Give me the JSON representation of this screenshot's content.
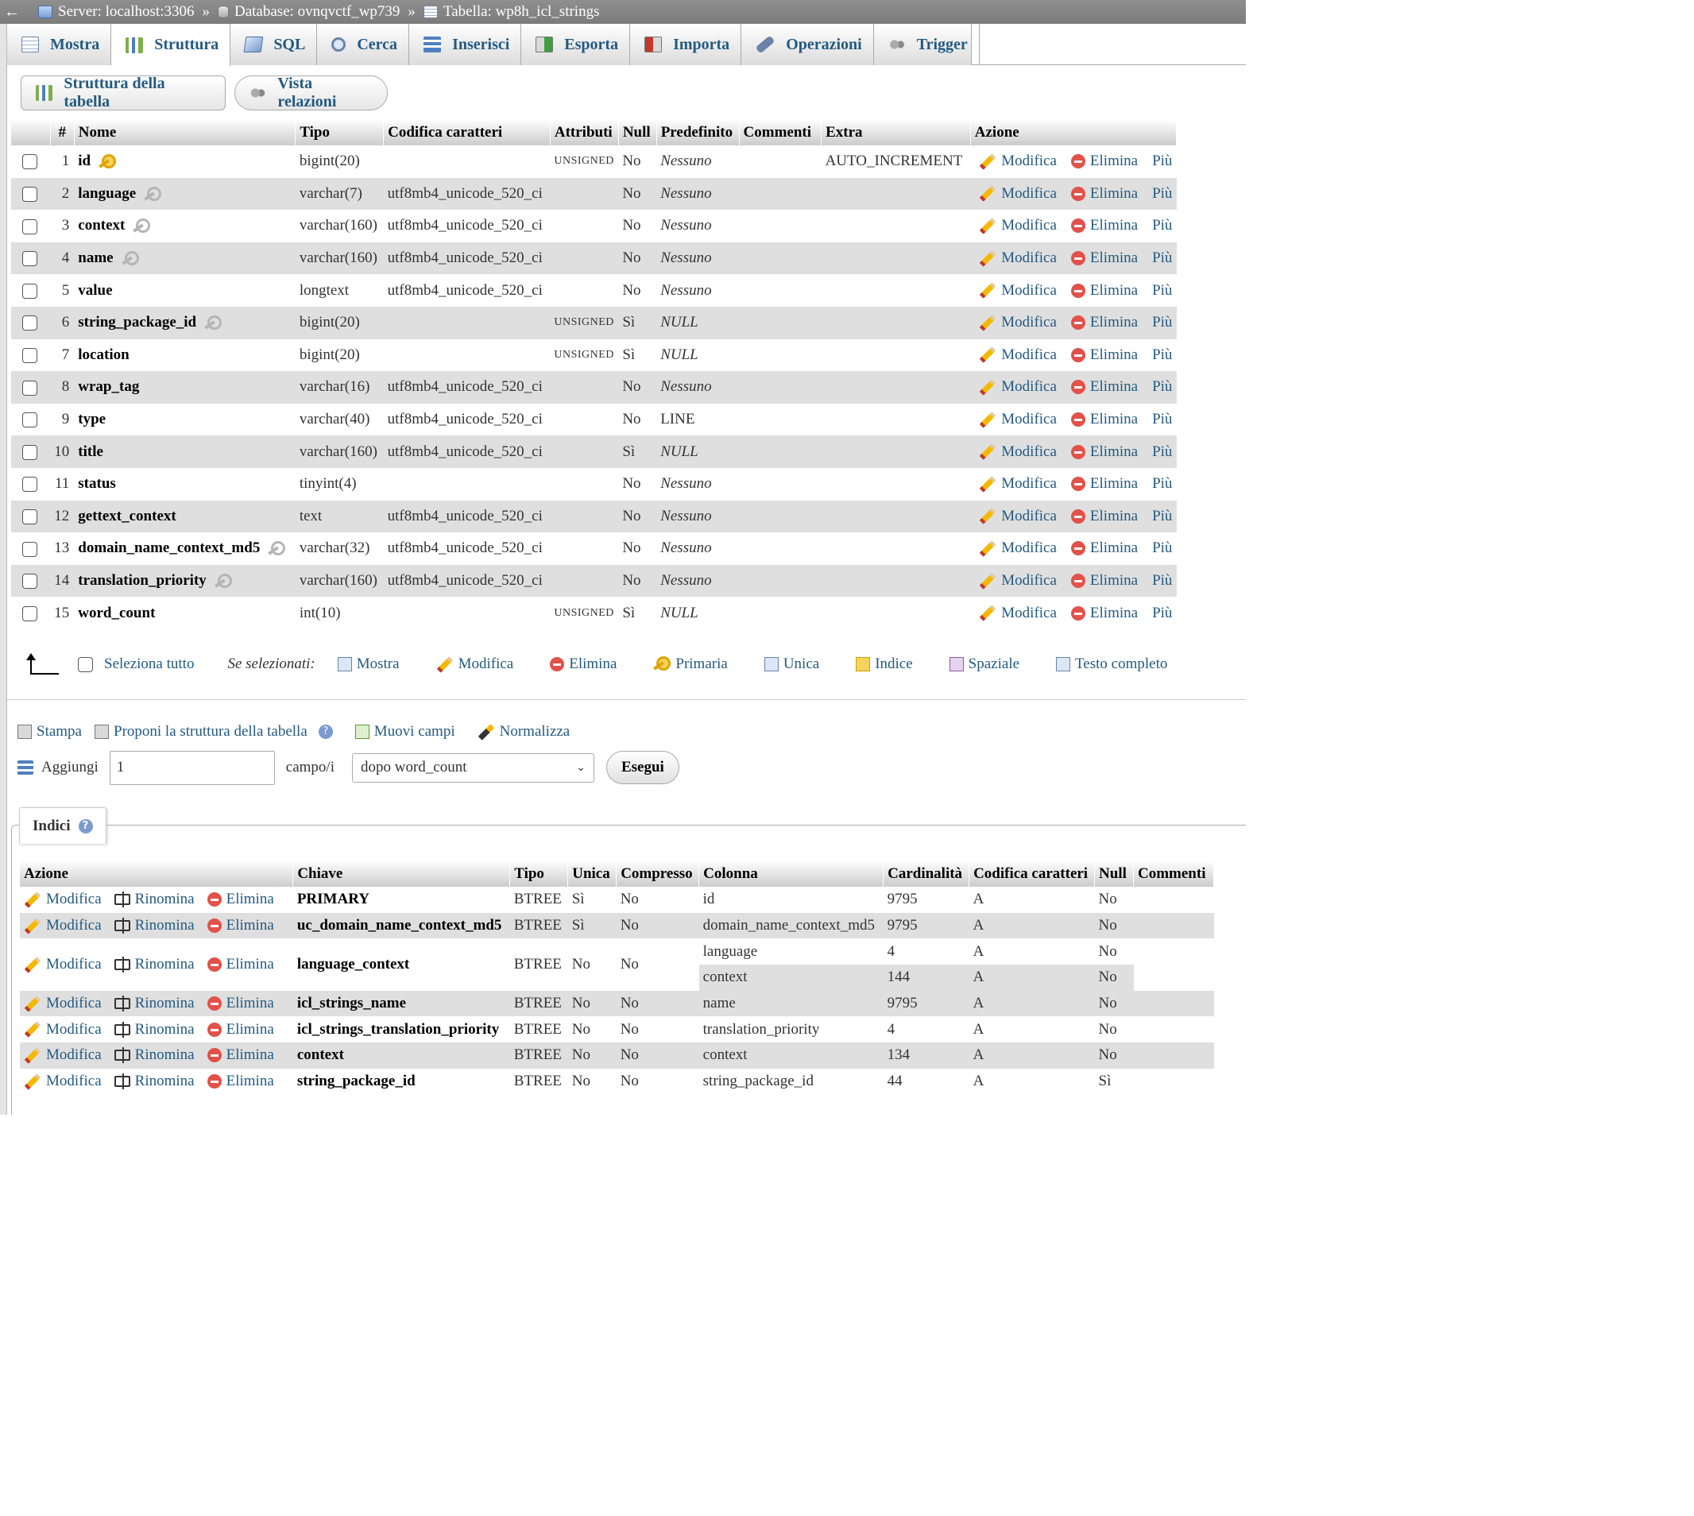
{
  "breadcrumb": {
    "back": "←",
    "server": "Server: localhost:3306",
    "database": "Database: ovnqvctf_wp739",
    "table": "Tabella: wp8h_icl_strings",
    "separator": "»"
  },
  "tabs": [
    {
      "label": "Mostra",
      "icon": "table-icon"
    },
    {
      "label": "Struttura",
      "icon": "structure-icon"
    },
    {
      "label": "SQL",
      "icon": "sql-icon"
    },
    {
      "label": "Cerca",
      "icon": "search-icon"
    },
    {
      "label": "Inserisci",
      "icon": "insert-icon"
    },
    {
      "label": "Esporta",
      "icon": "export-icon"
    },
    {
      "label": "Importa",
      "icon": "import-icon"
    },
    {
      "label": "Operazioni",
      "icon": "wrench-icon"
    },
    {
      "label": "Trigger",
      "icon": "trigger-icon"
    }
  ],
  "active_tab": "Struttura",
  "subnav": {
    "structure": "Struttura della tabella",
    "relations": "Vista relazioni"
  },
  "structure": {
    "headers": [
      "#",
      "Nome",
      "Tipo",
      "Codifica caratteri",
      "Attributi",
      "Null",
      "Predefinito",
      "Commenti",
      "Extra",
      "Azione"
    ],
    "actions": {
      "edit": "Modifica",
      "delete": "Elimina",
      "more": "Più"
    },
    "rows": [
      {
        "n": "1",
        "name": "id",
        "key": "primary",
        "type": "bigint(20)",
        "collation": "",
        "attr": "UNSIGNED",
        "null": "No",
        "default": "Nessuno",
        "italic": true,
        "extra": "AUTO_INCREMENT"
      },
      {
        "n": "2",
        "name": "language",
        "key": "index",
        "type": "varchar(7)",
        "collation": "utf8mb4_unicode_520_ci",
        "attr": "",
        "null": "No",
        "default": "Nessuno",
        "italic": true,
        "extra": ""
      },
      {
        "n": "3",
        "name": "context",
        "key": "index",
        "type": "varchar(160)",
        "collation": "utf8mb4_unicode_520_ci",
        "attr": "",
        "null": "No",
        "default": "Nessuno",
        "italic": true,
        "extra": ""
      },
      {
        "n": "4",
        "name": "name",
        "key": "index",
        "type": "varchar(160)",
        "collation": "utf8mb4_unicode_520_ci",
        "attr": "",
        "null": "No",
        "default": "Nessuno",
        "italic": true,
        "extra": ""
      },
      {
        "n": "5",
        "name": "value",
        "key": "",
        "type": "longtext",
        "collation": "utf8mb4_unicode_520_ci",
        "attr": "",
        "null": "No",
        "default": "Nessuno",
        "italic": true,
        "extra": ""
      },
      {
        "n": "6",
        "name": "string_package_id",
        "key": "index",
        "type": "bigint(20)",
        "collation": "",
        "attr": "UNSIGNED",
        "null": "Sì",
        "default": "NULL",
        "italic": true,
        "extra": ""
      },
      {
        "n": "7",
        "name": "location",
        "key": "",
        "type": "bigint(20)",
        "collation": "",
        "attr": "UNSIGNED",
        "null": "Sì",
        "default": "NULL",
        "italic": true,
        "extra": ""
      },
      {
        "n": "8",
        "name": "wrap_tag",
        "key": "",
        "type": "varchar(16)",
        "collation": "utf8mb4_unicode_520_ci",
        "attr": "",
        "null": "No",
        "default": "Nessuno",
        "italic": true,
        "extra": ""
      },
      {
        "n": "9",
        "name": "type",
        "key": "",
        "type": "varchar(40)",
        "collation": "utf8mb4_unicode_520_ci",
        "attr": "",
        "null": "No",
        "default": "LINE",
        "italic": false,
        "extra": ""
      },
      {
        "n": "10",
        "name": "title",
        "key": "",
        "type": "varchar(160)",
        "collation": "utf8mb4_unicode_520_ci",
        "attr": "",
        "null": "Sì",
        "default": "NULL",
        "italic": true,
        "extra": ""
      },
      {
        "n": "11",
        "name": "status",
        "key": "",
        "type": "tinyint(4)",
        "collation": "",
        "attr": "",
        "null": "No",
        "default": "Nessuno",
        "italic": true,
        "extra": ""
      },
      {
        "n": "12",
        "name": "gettext_context",
        "key": "",
        "type": "text",
        "collation": "utf8mb4_unicode_520_ci",
        "attr": "",
        "null": "No",
        "default": "Nessuno",
        "italic": true,
        "extra": ""
      },
      {
        "n": "13",
        "name": "domain_name_context_md5",
        "key": "index",
        "type": "varchar(32)",
        "collation": "utf8mb4_unicode_520_ci",
        "attr": "",
        "null": "No",
        "default": "Nessuno",
        "italic": true,
        "extra": ""
      },
      {
        "n": "14",
        "name": "translation_priority",
        "key": "index",
        "type": "varchar(160)",
        "collation": "utf8mb4_unicode_520_ci",
        "attr": "",
        "null": "No",
        "default": "Nessuno",
        "italic": true,
        "extra": ""
      },
      {
        "n": "15",
        "name": "word_count",
        "key": "",
        "type": "int(10)",
        "collation": "",
        "attr": "UNSIGNED",
        "null": "Sì",
        "default": "NULL",
        "italic": true,
        "extra": ""
      }
    ]
  },
  "selection": {
    "select_all": "Seleziona tutto",
    "if_selected": "Se selezionati:",
    "actions": [
      "Mostra",
      "Modifica",
      "Elimina",
      "Primaria",
      "Unica",
      "Indice",
      "Spaziale",
      "Testo completo"
    ]
  },
  "tools": {
    "print": "Stampa",
    "propose": "Proponi la struttura della tabella",
    "move": "Muovi campi",
    "normalize": "Normalizza"
  },
  "add": {
    "label": "Aggiungi",
    "count": "1",
    "fields_label": "campo/i",
    "position": "dopo word_count",
    "go": "Esegui"
  },
  "indexes": {
    "tab": "Indici",
    "headers": [
      "Azione",
      "Chiave",
      "Tipo",
      "Unica",
      "Compresso",
      "Colonna",
      "Cardinalità",
      "Codifica caratteri",
      "Null",
      "Commenti"
    ],
    "actions": {
      "edit": "Modifica",
      "rename": "Rinomina",
      "delete": "Elimina"
    },
    "rows": [
      {
        "key": "PRIMARY",
        "type": "BTREE",
        "unique": "Sì",
        "packed": "No",
        "cols": [
          {
            "col": "id",
            "card": "9795",
            "coll": "A",
            "null": "No"
          }
        ]
      },
      {
        "key": "uc_domain_name_context_md5",
        "type": "BTREE",
        "unique": "Sì",
        "packed": "No",
        "cols": [
          {
            "col": "domain_name_context_md5",
            "card": "9795",
            "coll": "A",
            "null": "No"
          }
        ]
      },
      {
        "key": "language_context",
        "type": "BTREE",
        "unique": "No",
        "packed": "No",
        "cols": [
          {
            "col": "language",
            "card": "4",
            "coll": "A",
            "null": "No"
          },
          {
            "col": "context",
            "card": "144",
            "coll": "A",
            "null": "No"
          }
        ]
      },
      {
        "key": "icl_strings_name",
        "type": "BTREE",
        "unique": "No",
        "packed": "No",
        "cols": [
          {
            "col": "name",
            "card": "9795",
            "coll": "A",
            "null": "No"
          }
        ]
      },
      {
        "key": "icl_strings_translation_priority",
        "type": "BTREE",
        "unique": "No",
        "packed": "No",
        "cols": [
          {
            "col": "translation_priority",
            "card": "4",
            "coll": "A",
            "null": "No"
          }
        ]
      },
      {
        "key": "context",
        "type": "BTREE",
        "unique": "No",
        "packed": "No",
        "cols": [
          {
            "col": "context",
            "card": "134",
            "coll": "A",
            "null": "No"
          }
        ]
      },
      {
        "key": "string_package_id",
        "type": "BTREE",
        "unique": "No",
        "packed": "No",
        "cols": [
          {
            "col": "string_package_id",
            "card": "44",
            "coll": "A",
            "null": "Sì"
          }
        ]
      }
    ]
  },
  "colors": {
    "link": "#235a81",
    "row_alt": "#dfdfdf",
    "topbar": "#858585"
  }
}
